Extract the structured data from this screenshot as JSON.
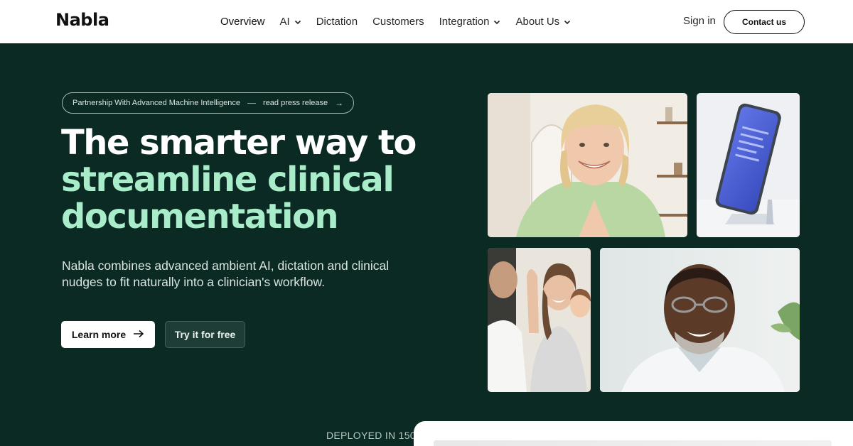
{
  "brand": {
    "logo_text": "Nabla"
  },
  "nav": {
    "items": [
      {
        "label": "Overview",
        "has_dropdown": false,
        "active": true
      },
      {
        "label": "AI",
        "has_dropdown": true
      },
      {
        "label": "Dictation",
        "has_dropdown": false
      },
      {
        "label": "Customers",
        "has_dropdown": false
      },
      {
        "label": "Integration",
        "has_dropdown": true
      },
      {
        "label": "About Us",
        "has_dropdown": true
      }
    ],
    "sign_in": "Sign in",
    "contact": "Contact us"
  },
  "hero": {
    "announcement": {
      "text": "Partnership With Advanced Machine Intelligence",
      "link": "read press release",
      "arrow": "→"
    },
    "headline_line1": "The smarter way to",
    "headline_accent_line2": "streamline clinical",
    "headline_accent_line3": "documentation",
    "subtext": "Nabla combines advanced ambient AI, dictation and clinical nudges to fit naturally into a clinician's workflow.",
    "primary_cta": "Learn more",
    "primary_cta_arrow": "→",
    "secondary_cta": "Try it for free"
  },
  "photos": [
    {
      "icon": "photo-smiling-woman"
    },
    {
      "icon": "photo-phone-on-stand"
    },
    {
      "icon": "photo-family-high-five"
    },
    {
      "icon": "photo-smiling-doctor"
    }
  ],
  "bottom": {
    "deployed_text": "DEPLOYED IN 150+"
  },
  "colors": {
    "background": "#0a2a23",
    "accent": "#a9ecc9",
    "header_bg": "#ffffff"
  }
}
